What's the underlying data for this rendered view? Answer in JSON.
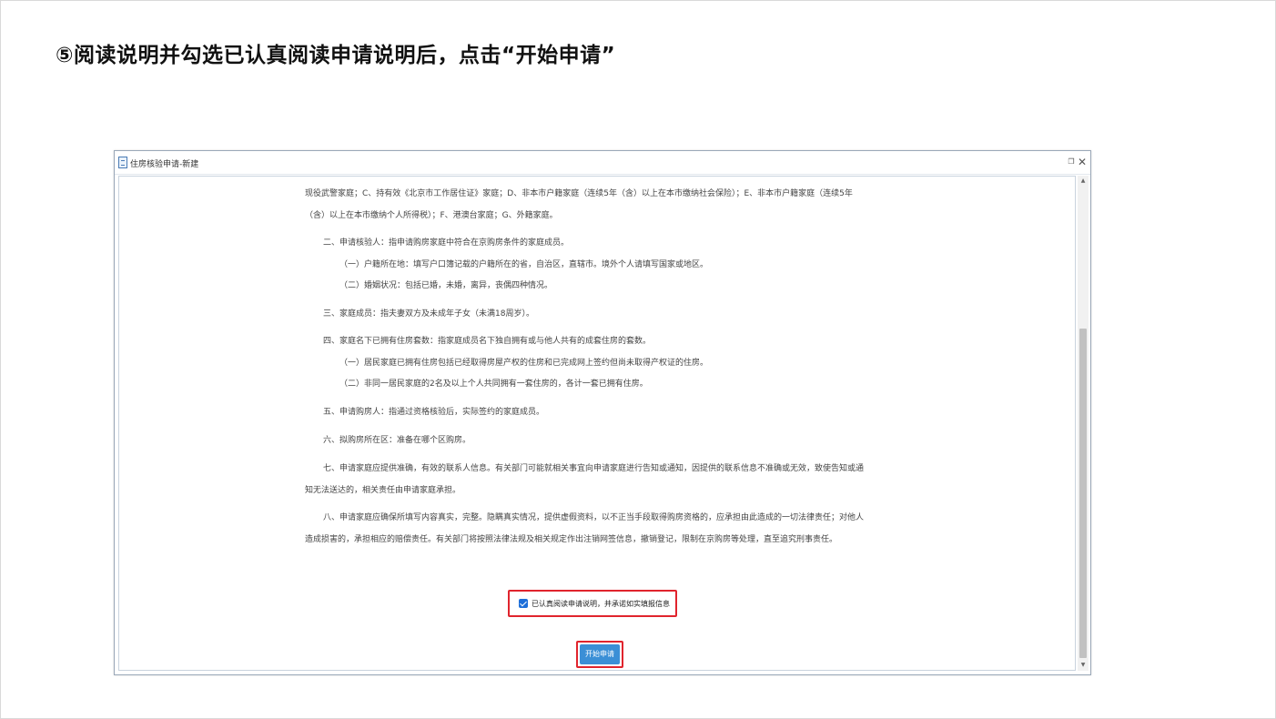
{
  "slide": {
    "title": "⑤阅读说明并勾选已认真阅读申请说明后，点击“开始申请”"
  },
  "dialog": {
    "title": "住房核验申请-新建",
    "paragraphs": [
      "现役武警家庭；C、持有效《北京市工作居住证》家庭；D、非本市户籍家庭（连续5年（含）以上在本市缴纳社会保险）；E、非本市户籍家庭（连续5年",
      "（含）以上在本市缴纳个人所得税）；F、港澳台家庭；G、外籍家庭。",
      "二、申请核验人：指申请购房家庭中符合在京购房条件的家庭成员。",
      "（一）户籍所在地：填写户口簿记载的户籍所在的省，自治区，直辖市。境外个人请填写国家或地区。",
      "（二）婚姻状况：包括已婚，未婚，离异，丧偶四种情况。",
      "三、家庭成员：指夫妻双方及未成年子女（未满18周岁）。",
      "四、家庭名下已拥有住房套数：指家庭成员名下独自拥有或与他人共有的成套住房的套数。",
      "（一）居民家庭已拥有住房包括已经取得房屋产权的住房和已完成网上签约但尚未取得产权证的住房。",
      "（二）非同一居民家庭的2名及以上个人共同拥有一套住房的，各计一套已拥有住房。",
      "五、申请购房人：指通过资格核验后，实际签约的家庭成员。",
      "六、拟购房所在区：准备在哪个区购房。",
      "七、申请家庭应提供准确，有效的联系人信息。有关部门可能就相关事宜向申请家庭进行告知或通知，因提供的联系信息不准确或无效，致使告知或通",
      "知无法送达的，相关责任由申请家庭承担。",
      "八、申请家庭应确保所填写内容真实，完整。隐瞒真实情况，提供虚假资料，以不正当手段取得购房资格的，应承担由此造成的一切法律责任；对他人",
      "造成损害的，承担相应的赔偿责任。有关部门将按照法律法规及相关规定作出注销网签信息，撤销登记，限制在京购房等处理，直至追究刑事责任。"
    ],
    "agree_label": "已认真阅读申请说明，并承诺如实填报信息",
    "agree_checked": true,
    "start_button": "开始申请",
    "colors": {
      "highlight_border": "#e0242d",
      "button_bg": "#3b8fd6",
      "checkbox": "#1e6fd9"
    }
  }
}
